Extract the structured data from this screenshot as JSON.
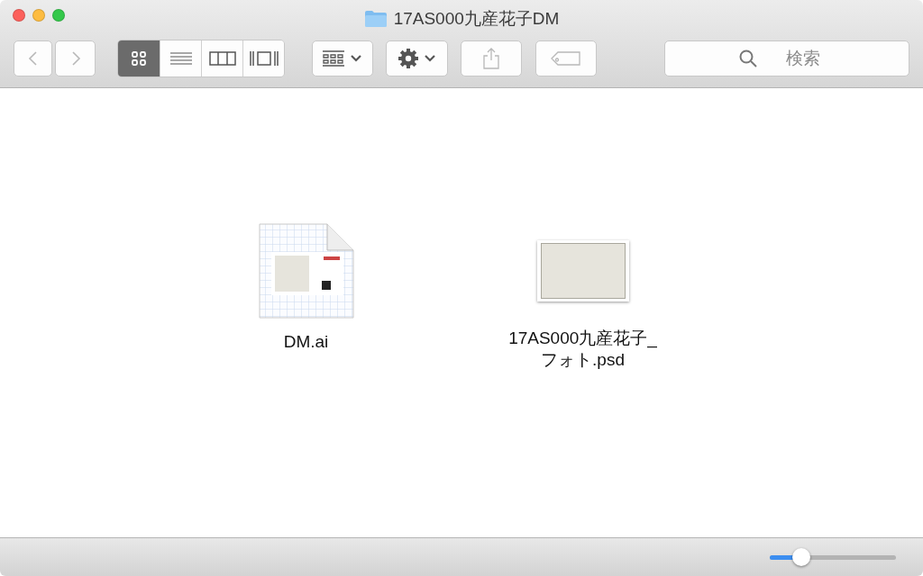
{
  "window": {
    "title": "17AS000九産花子DM"
  },
  "toolbar": {
    "navigation": [
      {
        "kind": "back",
        "disabled": true
      },
      {
        "kind": "forward",
        "disabled": true
      }
    ],
    "view_modes": [
      {
        "kind": "icons",
        "selected": true
      },
      {
        "kind": "list",
        "selected": false
      },
      {
        "kind": "columns",
        "selected": false
      },
      {
        "kind": "gallery",
        "selected": false
      }
    ],
    "actions": [
      {
        "kind": "arrange",
        "disabled": false
      },
      {
        "kind": "action",
        "disabled": false
      },
      {
        "kind": "share",
        "disabled": true
      },
      {
        "kind": "tag",
        "disabled": true
      }
    ],
    "search": {
      "placeholder": "検索"
    }
  },
  "files": [
    {
      "kind": "illustrator",
      "name": "DM.ai"
    },
    {
      "kind": "photo",
      "name": "17AS000九産花子_\nフォト.psd"
    }
  ],
  "status_bar": {
    "icon_size": {
      "level": 0.25
    }
  }
}
